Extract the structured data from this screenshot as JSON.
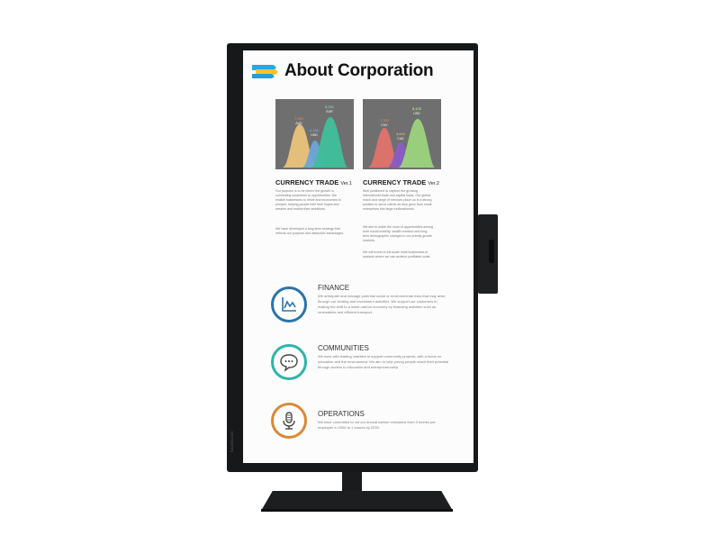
{
  "brand": "SAMSUNG",
  "page_title": "About Corporation",
  "colors": {
    "bezel": "#17181a",
    "finance": "#2b73a9",
    "communities": "#2fb5a6",
    "operations": "#d9893a"
  },
  "cards": [
    {
      "title": "CURRENCY TRADE",
      "version": "Ver.1",
      "chart_labels": [
        {
          "value": "7,580",
          "code": "AUD"
        },
        {
          "value": "4,180",
          "code": "HKD"
        },
        {
          "value": "8,251",
          "code": "EUR"
        }
      ],
      "paragraphs": [
        "Our purpose is to be where the growth is, connecting customers to opportunities. We enable businesses to thrive and economies to prosper, helping people fulfil their hopes and dreams and realise their ambitions.",
        "We have developed a long-term strategy that reflects our purpose and distinctive advantages."
      ]
    },
    {
      "title": "CURRENCY TRADE",
      "version": "Ver.2",
      "chart_labels": [
        {
          "value": "7,320",
          "code": "CNY"
        },
        {
          "value": "4,610",
          "code": "CAD"
        },
        {
          "value": "8,100",
          "code": "USD"
        }
      ],
      "paragraphs": [
        "Well positioned to capture the growing international trade and capital flows. Our global reach and range of services place us in a strong position to serve clients as they grow from small enterprises into large multinationals.",
        "We aim to make the most of opportunities arising from social mobility, wealth creation and long-term demographic changes in our priority growth markets.",
        "We will invest in full-scale retail businesses in markets where we can achieve profitable scale."
      ]
    }
  ],
  "services": [
    {
      "heading": "FINANCE",
      "icon": "line-chart-icon",
      "text": "We anticipate and manage potential social or environmental risks that may arise through our lending and investment activities. We support our customers in making the shift to a lower-carbon economy by financing activities such as renewables and efficient transport."
    },
    {
      "heading": "COMMUNITIES",
      "icon": "chat-bubble-icon",
      "text": "We work with leading charities to support community projects, with a focus on education and the environment. We aim to help young people reach their potential through access to education and entrepreneurship."
    },
    {
      "heading": "OPERATIONS",
      "icon": "microphone-icon",
      "text": "We have committed to cut our annual carbon emissions from 3 tonnes per employee in 2000 to 1 tonnes by 2030."
    }
  ]
}
